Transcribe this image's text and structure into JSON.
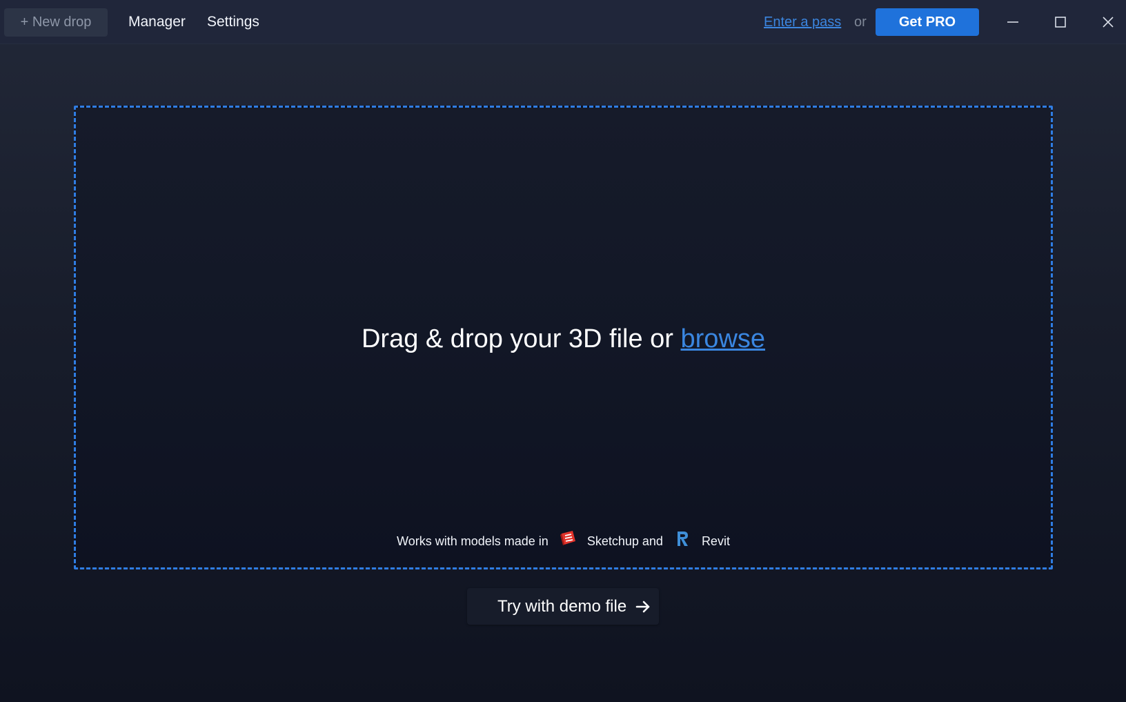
{
  "topbar": {
    "new_drop_label": "+ New drop",
    "nav": {
      "manager": "Manager",
      "settings": "Settings"
    },
    "enter_pass_label": "Enter a pass",
    "or_text": "or",
    "get_pro_label": "Get PRO",
    "window_controls": [
      "minimize-icon",
      "maximize-icon",
      "close-icon"
    ]
  },
  "dropzone": {
    "headline_prefix": "Drag & drop your 3D file or ",
    "browse_label": "browse",
    "works_with_prefix": "Works with models made in",
    "sketchup_label": "Sketchup and",
    "revit_label": "Revit",
    "icons": [
      "sketchup-logo-icon",
      "revit-logo-icon"
    ]
  },
  "demo": {
    "button_label": "Try with demo file",
    "icon": "arrow-right-icon"
  },
  "colors": {
    "accent": "#1f72db",
    "link": "#3a86e0",
    "dashed_border": "#2f7de3",
    "background_top": "#222838",
    "background_bottom": "#0f1320"
  }
}
